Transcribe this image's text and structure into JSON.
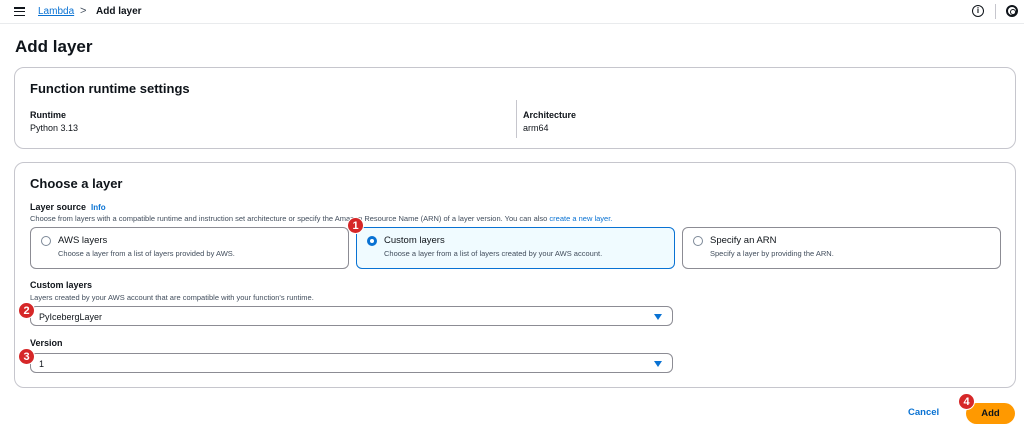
{
  "breadcrumb": {
    "parent": "Lambda",
    "separator": ">",
    "current": "Add layer"
  },
  "topbar": {
    "info_icon": "info-icon",
    "settings_icon": "settings-icon",
    "info_glyph": "i"
  },
  "page": {
    "title": "Add layer"
  },
  "runtime_settings": {
    "title": "Function runtime settings",
    "runtime_label": "Runtime",
    "runtime_value": "Python 3.13",
    "architecture_label": "Architecture",
    "architecture_value": "arm64"
  },
  "choose_layer": {
    "title": "Choose a layer",
    "source_label": "Layer source",
    "info_link": "Info",
    "source_description": "Choose from layers with a compatible runtime and instruction set architecture or specify the Amazon Resource Name (ARN) of a layer version. You can also",
    "create_link": "create a new layer.",
    "options": [
      {
        "title": "AWS layers",
        "description": "Choose a layer from a list of layers provided by AWS.",
        "selected": false
      },
      {
        "title": "Custom layers",
        "description": "Choose a layer from a list of layers created by your AWS account.",
        "selected": true
      },
      {
        "title": "Specify an ARN",
        "description": "Specify a layer by providing the ARN.",
        "selected": false
      }
    ],
    "custom_layers_label": "Custom layers",
    "custom_layers_description": "Layers created by your AWS account that are compatible with your function's runtime.",
    "custom_layers_value": "PyIcebergLayer",
    "version_label": "Version",
    "version_value": "1"
  },
  "actions": {
    "cancel_label": "Cancel",
    "add_label": "Add"
  },
  "annotations": [
    "1",
    "2",
    "3",
    "4"
  ],
  "colors": {
    "accent": "#0972d3",
    "primary_button": "#ff9900",
    "badge": "#d62728"
  }
}
